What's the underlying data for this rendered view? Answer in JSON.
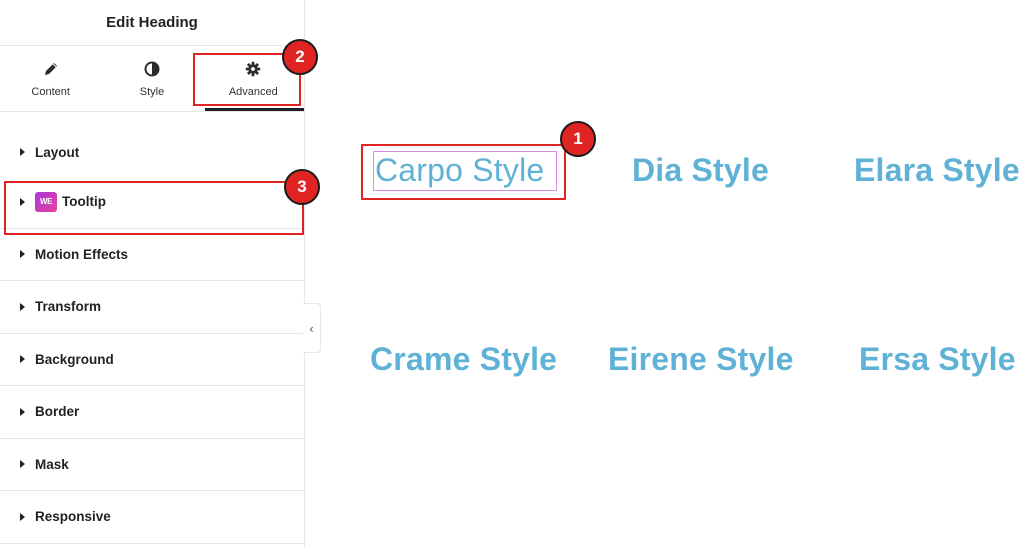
{
  "panel": {
    "title": "Edit Heading",
    "tabs": [
      {
        "label": "Content",
        "icon": "pencil-icon"
      },
      {
        "label": "Style",
        "icon": "half-circle-icon"
      },
      {
        "label": "Advanced",
        "icon": "gear-icon",
        "active": true
      }
    ],
    "sections": [
      {
        "label": "Layout"
      },
      {
        "label": "Tooltip",
        "badge": "WE"
      },
      {
        "label": "Motion Effects"
      },
      {
        "label": "Transform"
      },
      {
        "label": "Background"
      },
      {
        "label": "Border"
      },
      {
        "label": "Mask"
      },
      {
        "label": "Responsive"
      }
    ],
    "collapse_glyph": "‹"
  },
  "canvas": {
    "headings": [
      "Carpo Style",
      "Dia Style",
      "Elara Style",
      "Crame Style",
      "Eirene Style",
      "Ersa Style"
    ],
    "heading_color": "#5fb2d6"
  },
  "annotations": {
    "markers": [
      "1",
      "2",
      "3"
    ],
    "color": "#e02424"
  }
}
